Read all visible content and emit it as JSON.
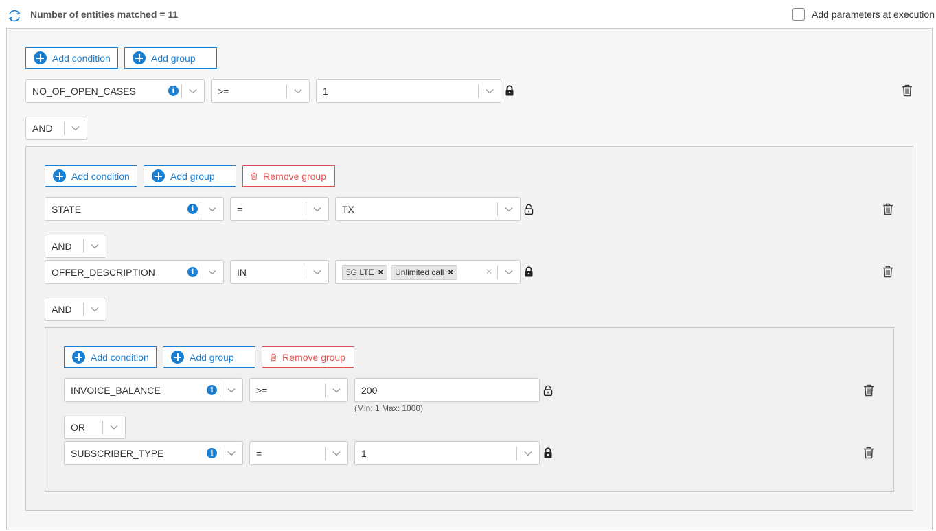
{
  "header": {
    "title": "Number of entities matched = 11",
    "exec_label": "Add parameters at execution"
  },
  "buttons": {
    "add_condition": "Add condition",
    "add_group": "Add group",
    "remove_group": "Remove group"
  },
  "root": {
    "condition1": {
      "field": "NO_OF_OPEN_CASES",
      "operator": ">=",
      "value": "1",
      "lock": "locked"
    },
    "connector1": "AND"
  },
  "group2": {
    "condition1": {
      "field": "STATE",
      "operator": "=",
      "value": "TX",
      "lock": "unlocked"
    },
    "connector1": "AND",
    "condition2": {
      "field": "OFFER_DESCRIPTION",
      "operator": "IN",
      "chips": [
        "5G LTE",
        "Unlimited call"
      ],
      "lock": "locked"
    },
    "connector2": "AND"
  },
  "group3": {
    "condition1": {
      "field": "INVOICE_BALANCE",
      "operator": ">=",
      "value": "200",
      "hint": "(Min: 1 Max: 1000)",
      "lock": "unlocked"
    },
    "connector1": "OR",
    "condition2": {
      "field": "SUBSCRIBER_TYPE",
      "operator": "=",
      "value": "1",
      "lock": "locked"
    }
  },
  "icons": {
    "refresh": "refresh-icon",
    "add": "plus-circle-icon",
    "info": "info-icon",
    "chevron": "chevron-down-icon",
    "lock": "lock-icon",
    "unlock": "unlock-icon",
    "trash": "trash-icon"
  },
  "colors": {
    "accent": "#1b7fd1",
    "danger": "#e05252"
  }
}
